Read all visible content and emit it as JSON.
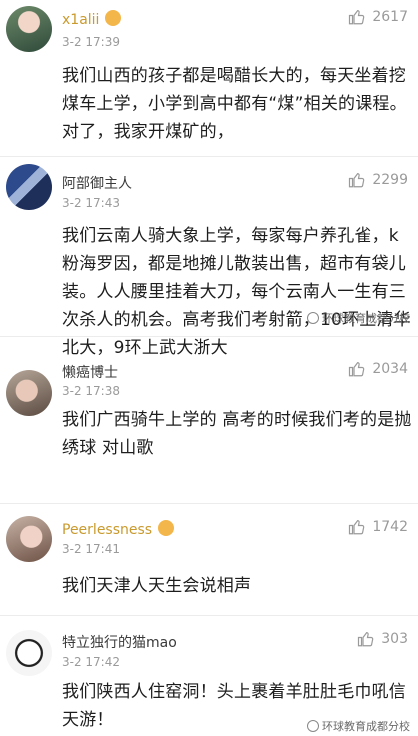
{
  "comments": [
    {
      "username": "x1alii",
      "time": "3-2 17:39",
      "likes": "2617",
      "text": "我们山西的孩子都是喝醋长大的，每天坐着挖煤车上学，小学到高中都有“煤”相关的课程。对了，我家开煤矿的，"
    },
    {
      "username": "阿部御主人",
      "time": "3-2 17:43",
      "likes": "2299",
      "text": "我们云南人骑大象上学，每家每户养孔雀，k粉海罗因，都是地摊儿散装出售，超市有袋儿装。人人腰里挂着大刀，每个云南人一生有三次杀人的机会。高考我们考射箭，10环上清华北大，9环上武大浙大"
    },
    {
      "username": "懒癌博士",
      "time": "3-2 17:38",
      "likes": "2034",
      "text": "我们广西骑牛上学的 高考的时候我们考的是抛绣球 对山歌"
    },
    {
      "username": "Peerlessness",
      "time": "3-2 17:41",
      "likes": "1742",
      "text": "我们天津人天生会说相声"
    },
    {
      "username": "特立独行的猫mao",
      "time": "3-2 17:42",
      "likes": "303",
      "text": "我们陕西人住窑洞！头上裹着羊肚肚毛巾吼信天游！"
    }
  ],
  "watermark": "环球教育成都分校",
  "colors": {
    "gold_name": "#c99a2e",
    "meta_gray": "#9a9a9a",
    "emoji": "#f6c443"
  }
}
